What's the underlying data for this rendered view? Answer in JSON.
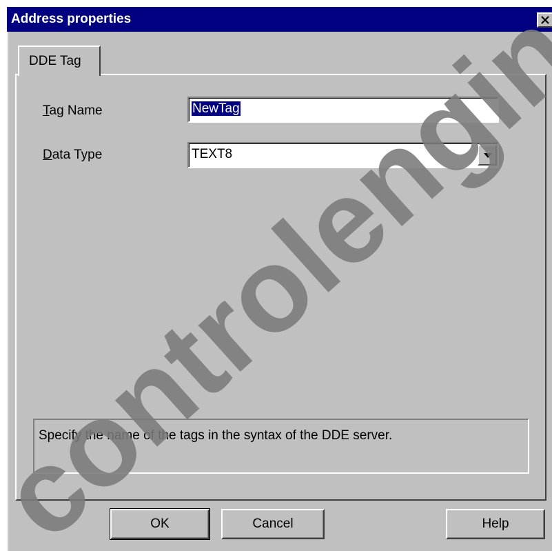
{
  "dialog": {
    "title": "Address properties"
  },
  "tabs": [
    {
      "label": "DDE Tag"
    }
  ],
  "fields": {
    "tag_name": {
      "label_mnemonic": "T",
      "label_rest": "ag Name",
      "value": "NewTag"
    },
    "data_type": {
      "label_mnemonic": "D",
      "label_rest": "ata Type",
      "value": "TEXT8"
    }
  },
  "help_text": "Specify the name of the tags in the syntax of the DDE server.",
  "buttons": {
    "ok": "OK",
    "cancel": "Cancel",
    "help": "Help"
  },
  "watermark": {
    "text": "controlengineering",
    "color": "#7a7a7a"
  },
  "colors": {
    "titlebar": "#000080",
    "face": "#c0c0c0",
    "selection": "#000080"
  }
}
